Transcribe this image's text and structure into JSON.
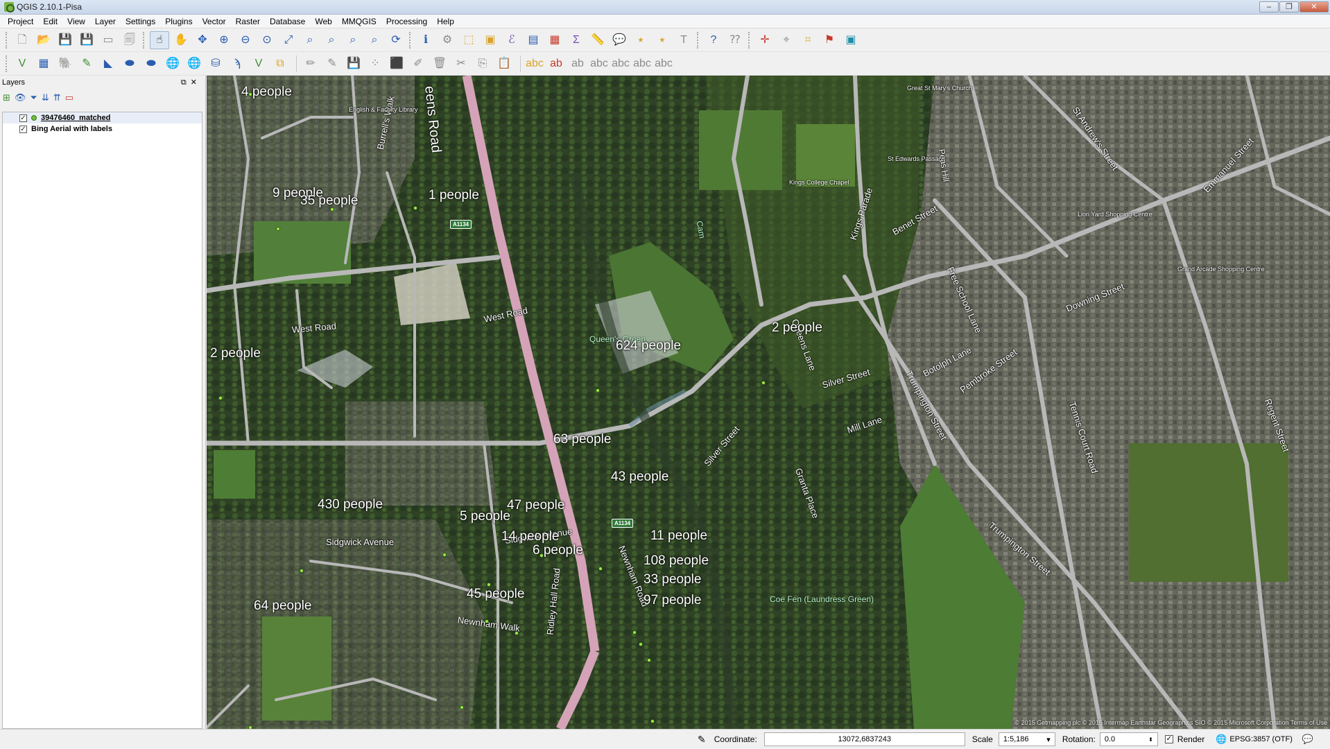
{
  "window": {
    "title": "QGIS 2.10.1-Pisa",
    "controls": [
      "–",
      "❐",
      "✕"
    ]
  },
  "menu": [
    "Project",
    "Edit",
    "View",
    "Layer",
    "Settings",
    "Plugins",
    "Vector",
    "Raster",
    "Database",
    "Web",
    "MMQGIS",
    "Processing",
    "Help"
  ],
  "layers_panel": {
    "title": "Layers",
    "layers": [
      {
        "name": "39476460_matched",
        "checked": true
      },
      {
        "name": "Bing Aerial with labels",
        "checked": true
      }
    ]
  },
  "map": {
    "points": [
      {
        "label": "4 people"
      },
      {
        "label": "9 people"
      },
      {
        "label": "35 people"
      },
      {
        "label": "1 people"
      },
      {
        "label": "2 people"
      },
      {
        "label": "624 people"
      },
      {
        "label": "2 people"
      },
      {
        "label": "5 people"
      },
      {
        "label": "63 people"
      },
      {
        "label": "430 people"
      },
      {
        "label": "43 people"
      },
      {
        "label": "47 people"
      },
      {
        "label": "14 people"
      },
      {
        "label": "11 people"
      },
      {
        "label": "6 people"
      },
      {
        "label": "108 people"
      },
      {
        "label": "33 people"
      },
      {
        "label": "45 people"
      },
      {
        "label": "97 people"
      },
      {
        "label": "64 people"
      }
    ],
    "streets": [
      "eens Road",
      "West Road",
      "West Road",
      "Burrell's Walk",
      "Queen's Green",
      "Sidgwick Avenue",
      "Sidgwick Avenue",
      "Newnham Road",
      "Newnham Walk",
      "Ridley Hall Road",
      "Silver Street",
      "Silver Street",
      "Mill Lane",
      "Trumpington Street",
      "Botolph Lane",
      "Pembroke Street",
      "Downing Street",
      "Tennis Court Road",
      "Queens Lane",
      "Kings Parade",
      "Benet Street",
      "Free School Lane",
      "Granta Place",
      "Trumpington Street",
      "Coe Fen (Laundress Green)",
      "St Andrew's Street",
      "Regent Street",
      "Emmanuel Street",
      "Lion Yard Shopping Centre",
      "Grand Arcade Shopping Centre",
      "St Edwards Passage",
      "Peas Hill",
      "Kings College Chapel",
      "Great St Mary's Church",
      "English & Faculty Library",
      "Cam",
      "A1134",
      "A1134"
    ],
    "attribution": "© 2015 Getmapping plc © 2015 Intermap Earthstar Geographics SIO © 2015 Microsoft Corporation  Terms of Use"
  },
  "status": {
    "coordinate_label": "Coordinate:",
    "coordinate": "13072,6837243",
    "scale_label": "Scale",
    "scale": "1:5,186",
    "rotation_label": "Rotation:",
    "rotation": "0.0",
    "render_label": "Render",
    "render_checked": true,
    "crs": "EPSG:3857 (OTF)"
  },
  "colors": {
    "road_pink": "#d5a3b8",
    "road_gray": "#b8b8b8",
    "label_dot": "#9ee84a"
  }
}
